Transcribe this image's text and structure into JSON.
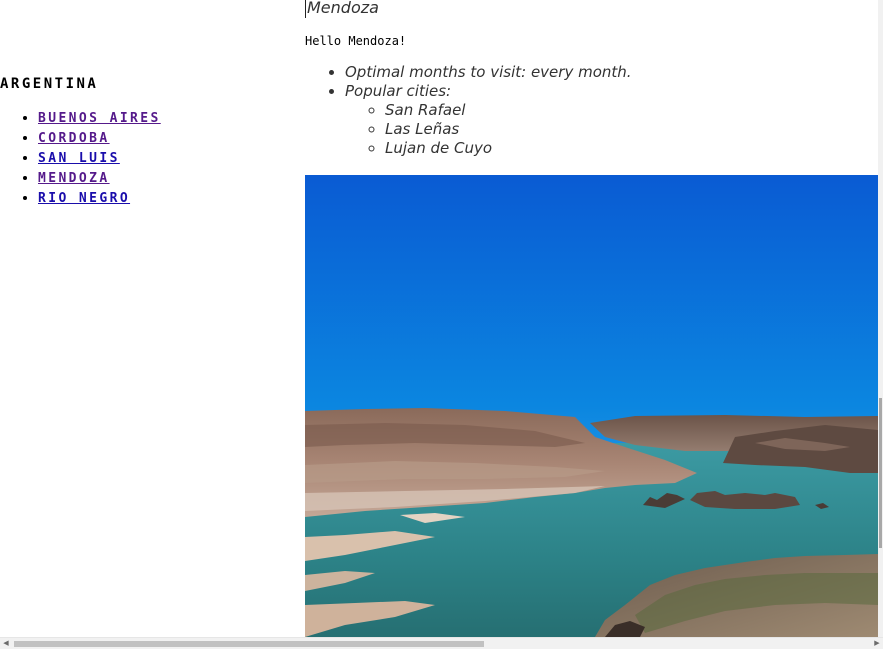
{
  "sidebar": {
    "heading": "ARGENTINA",
    "items": [
      {
        "label": "BUENOS AIRES"
      },
      {
        "label": "CORDOBA"
      },
      {
        "label": "SAN LUIS"
      },
      {
        "label": "MENDOZA"
      },
      {
        "label": "RIO NEGRO"
      }
    ]
  },
  "main": {
    "title": "Mendoza",
    "greeting": "Hello Mendoza!",
    "info": {
      "months": "Optimal months to visit: every month.",
      "popular_cities_label": "Popular cities:",
      "cities": [
        "San Rafael",
        "Las Leñas",
        "Lujan de Cuyo"
      ]
    }
  },
  "colors": {
    "link_visited": "#551a8b",
    "link_unvisited": "#1a0dab",
    "sky_top": "#0a5fd6",
    "water": "#2f8a8f"
  },
  "icons": {
    "scroll_left": "left-arrow-icon",
    "scroll_right": "right-arrow-icon"
  }
}
